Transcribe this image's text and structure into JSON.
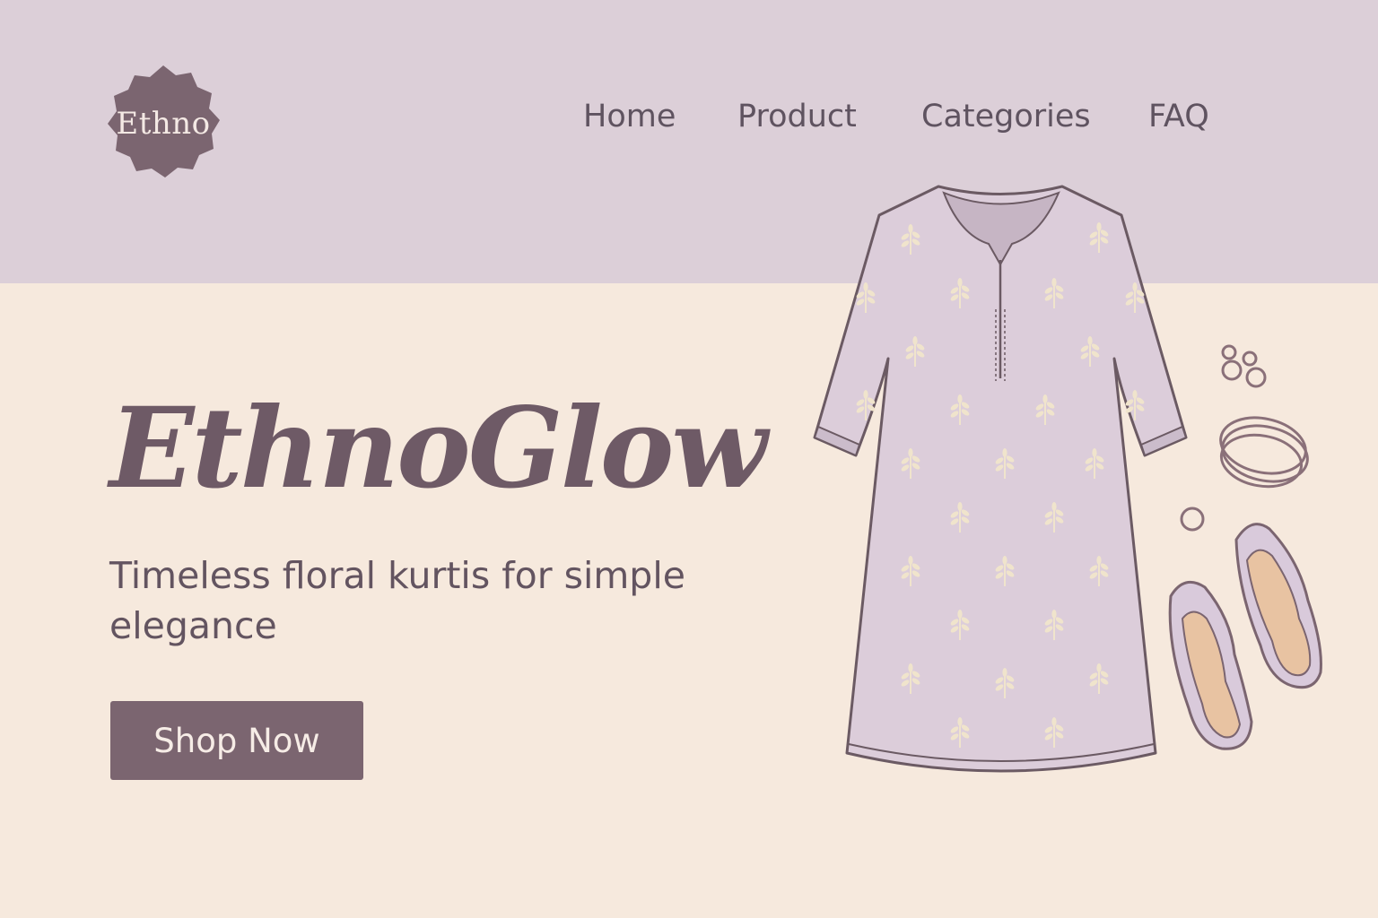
{
  "brand": {
    "logo_text": "Ethno",
    "title": "EthnoGlow",
    "tagline": "Timeless floral kurtis for simple elegance"
  },
  "nav": {
    "items": [
      {
        "label": "Home"
      },
      {
        "label": "Product"
      },
      {
        "label": "Categories"
      },
      {
        "label": "FAQ"
      }
    ]
  },
  "hero": {
    "cta_label": "Shop Now",
    "illustration_icons": [
      "kurti-icon",
      "earrings-icon",
      "bangles-icon",
      "ring-icon",
      "sandals-icon"
    ]
  },
  "colors": {
    "header_bg": "#dccfd8",
    "page_bg": "#f6e9dd",
    "accent": "#7b6570",
    "kurti_fill": "#dccdda",
    "motif": "#f0e4cc",
    "sole": "#e8c3a2"
  }
}
